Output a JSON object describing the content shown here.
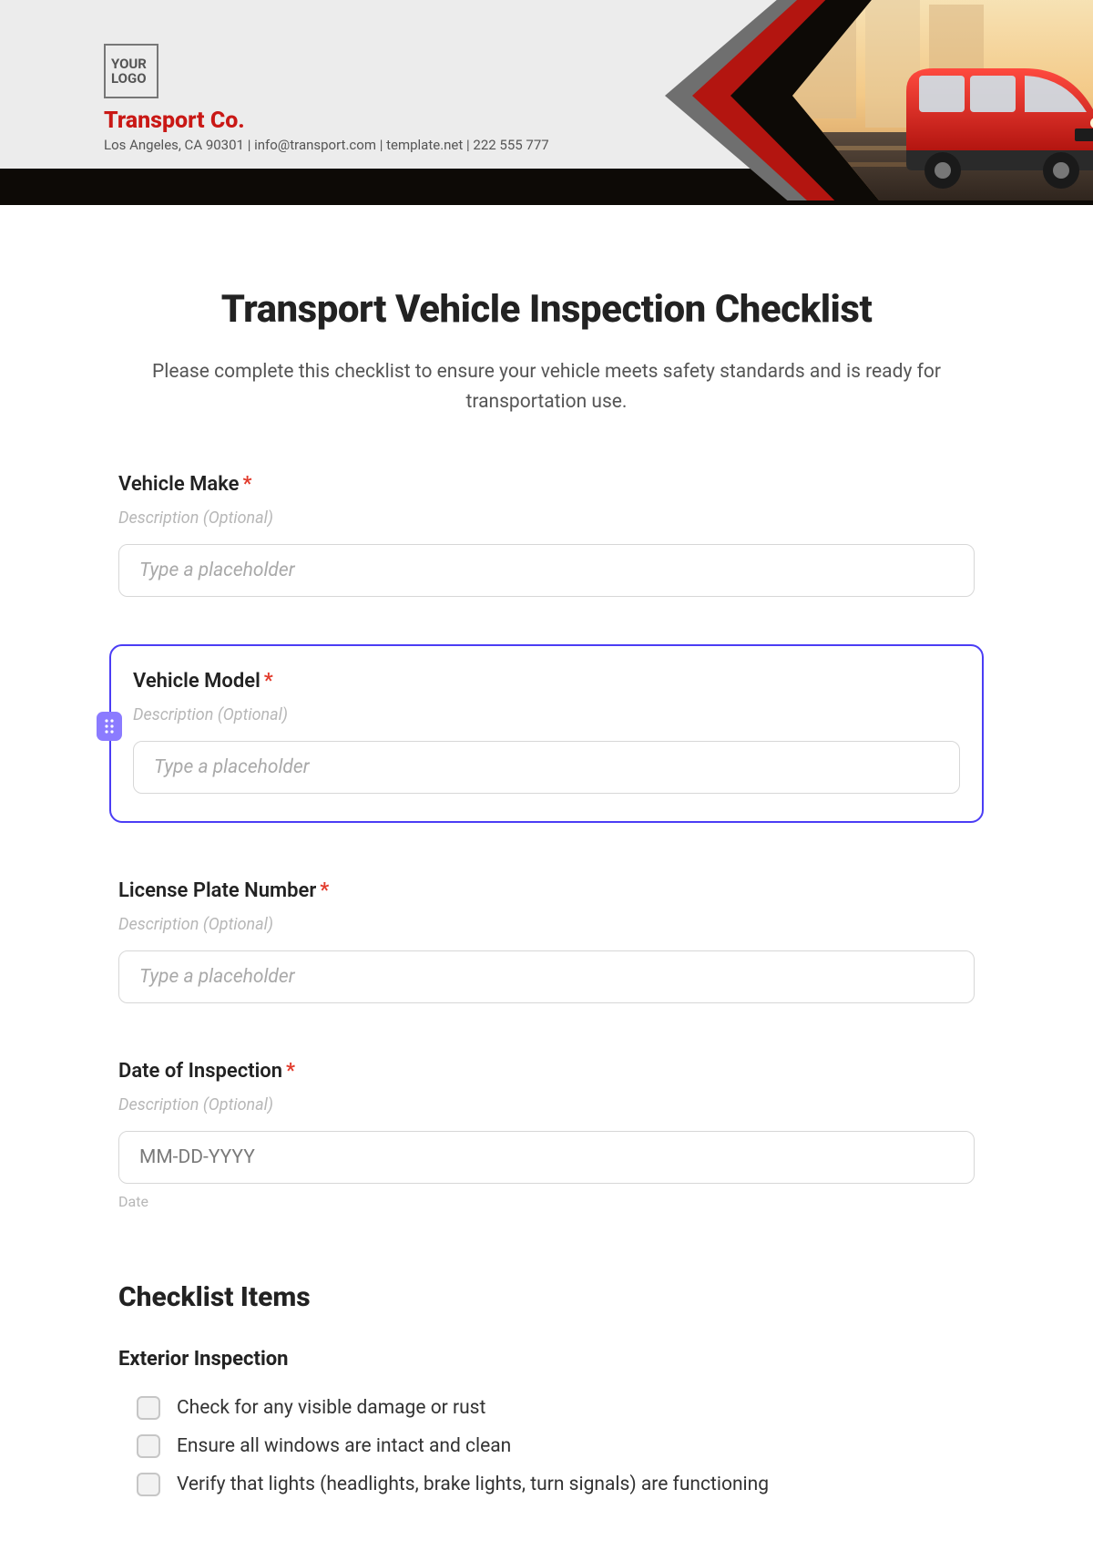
{
  "header": {
    "logo_text": "YOUR LOGO",
    "company_name": "Transport Co.",
    "contact_line": "Los Angeles, CA 90301 | info@transport.com | template.net | 222 555 777"
  },
  "form": {
    "title": "Transport Vehicle Inspection Checklist",
    "subtitle": "Please complete this checklist to ensure your vehicle meets safety standards and is ready for transportation use.",
    "fields": {
      "make": {
        "label": "Vehicle Make",
        "required": "*",
        "desc": "Description (Optional)",
        "placeholder": "Type a placeholder"
      },
      "model": {
        "label": "Vehicle Model",
        "required": "*",
        "desc": "Description (Optional)",
        "placeholder": "Type a placeholder"
      },
      "plate": {
        "label": "License Plate Number",
        "required": "*",
        "desc": "Description (Optional)",
        "placeholder": "Type a placeholder"
      },
      "date": {
        "label": "Date of Inspection",
        "required": "*",
        "desc": "Description (Optional)",
        "placeholder": "MM-DD-YYYY",
        "hint": "Date"
      }
    },
    "checklist": {
      "section_title": "Checklist Items",
      "groups": [
        {
          "title": "Exterior Inspection",
          "items": [
            "Check for any visible damage or rust",
            "Ensure all windows are intact and clean",
            "Verify that lights (headlights, brake lights, turn signals) are functioning"
          ]
        }
      ]
    }
  }
}
